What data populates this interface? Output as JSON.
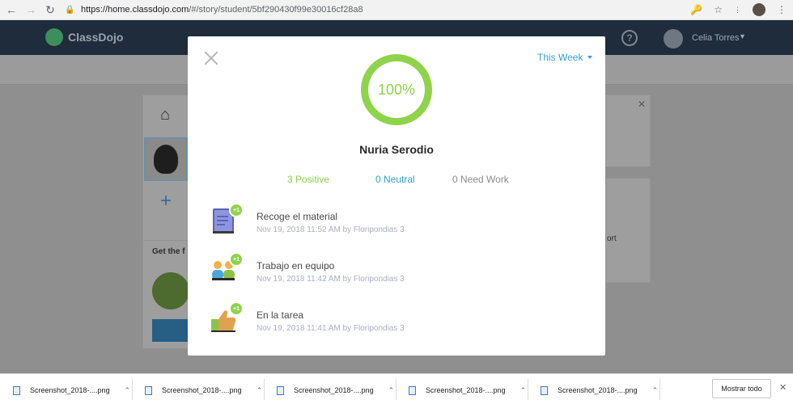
{
  "browser": {
    "url_host": "https://home.classdojo.com",
    "url_path": "/#/story/student/5bf290430f99e30016cf28a8"
  },
  "app": {
    "logo_text": "ClassDojo",
    "user_name": "Celia Torres"
  },
  "background": {
    "get_text": "Get the f",
    "ort_text": "ort"
  },
  "modal": {
    "period": "This Week",
    "percent": "100%",
    "percent_value": 100,
    "student_name": "Nuria Serodio",
    "stats": {
      "positive": "3 Positive",
      "neutral": "0 Neutral",
      "need_work": "0 Need Work"
    },
    "awards": [
      {
        "title": "Recoge el material",
        "meta": "Nov 19, 2018 11:52 AM by Floripondias 3",
        "points": "+1",
        "icon": "book-icon"
      },
      {
        "title": "Trabajo en equipo",
        "meta": "Nov 19, 2018 11:42 AM by Floripondias 3",
        "points": "+1",
        "icon": "team-icon"
      },
      {
        "title": "En la tarea",
        "meta": "Nov 19, 2018 11:41 AM by Floripondias 3",
        "points": "+1",
        "icon": "thumbs-up-icon"
      }
    ]
  },
  "downloads": {
    "items": [
      "Screenshot_2018-....png",
      "Screenshot_2018-....png",
      "Screenshot_2018-....png",
      "Screenshot_2018-....png",
      "Screenshot_2018-....png"
    ],
    "show_all": "Mostrar todo"
  }
}
